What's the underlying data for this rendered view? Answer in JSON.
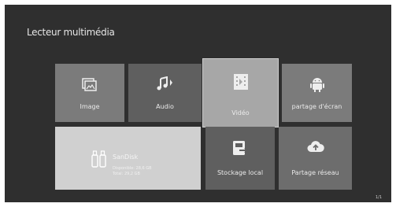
{
  "screen": {
    "title": "Lecteur multimédia"
  },
  "tiles": {
    "image": {
      "label": "Image",
      "icon": "image-icon"
    },
    "audio": {
      "label": "Audio",
      "icon": "music-note-icon"
    },
    "video": {
      "label": "Vidéo",
      "icon": "film-icon"
    },
    "share": {
      "label": "partage d'écran",
      "icon": "android-icon"
    },
    "sandisk": {
      "name": "SanDisk",
      "line1": "Disponible: 28,6 GB",
      "line2": "Total: 29,2 GB",
      "icon": "usb-drive-icon"
    },
    "local": {
      "label": "Stockage local",
      "icon": "local-storage-icon"
    },
    "network": {
      "label": "Partage réseau",
      "icon": "cloud-upload-icon"
    }
  },
  "footer": {
    "text": "1/1"
  },
  "colors": {
    "background": "#2f2f2f",
    "tile_selected": "#a7a7a7",
    "tile_sandisk": "#d0d0d0"
  }
}
